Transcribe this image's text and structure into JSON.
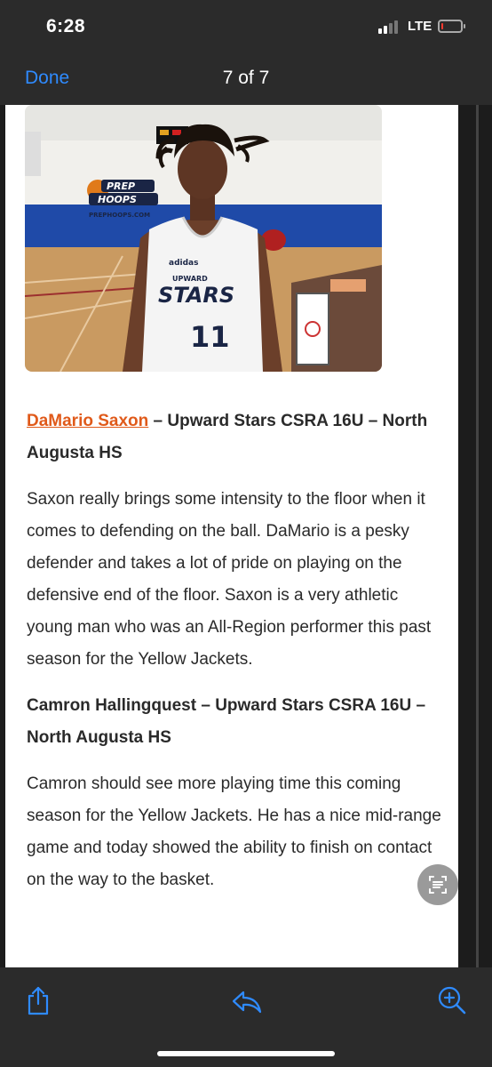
{
  "status": {
    "time": "6:28",
    "network": "LTE",
    "battery_level": 0.12,
    "battery_color": "#ff3b30",
    "signal_bars_active": 2,
    "signal_bars_total": 4
  },
  "nav": {
    "done_label": "Done",
    "page_indicator": "7 of 7",
    "accent_color": "#2f8bff"
  },
  "photo": {
    "logo_line1": "PREP",
    "logo_line2": "HOOPS",
    "logo_url": "PREPHOOPS.COM",
    "jersey_team_small": "UPWARD",
    "jersey_team": "STARS",
    "jersey_number": "11"
  },
  "article": {
    "player1": {
      "name": "DaMario Saxon",
      "details": " – Upward Stars CSRA 16U – North Augusta HS",
      "paragraph": "Saxon really brings some intensity to the floor when it comes to defending on the ball. DaMario is a pesky defender and takes a lot of pride on playing on the defensive end of the floor. Saxon is a very athletic young man who was an All-Region performer this past season for the Yellow Jackets."
    },
    "player2": {
      "heading": "Camron Hallingquest – Upward Stars CSRA 16U – North Augusta HS",
      "paragraph": "Camron should see more playing time this coming season for the Yellow Jackets. He has a nice mid-range game and today showed the ability to finish on contact on the way to the basket."
    },
    "link_color": "#e05a1a"
  },
  "toolbar": {
    "icons": [
      "share-icon",
      "reply-icon",
      "zoom-in-icon"
    ]
  },
  "reader_icon": "text-recognition-icon"
}
